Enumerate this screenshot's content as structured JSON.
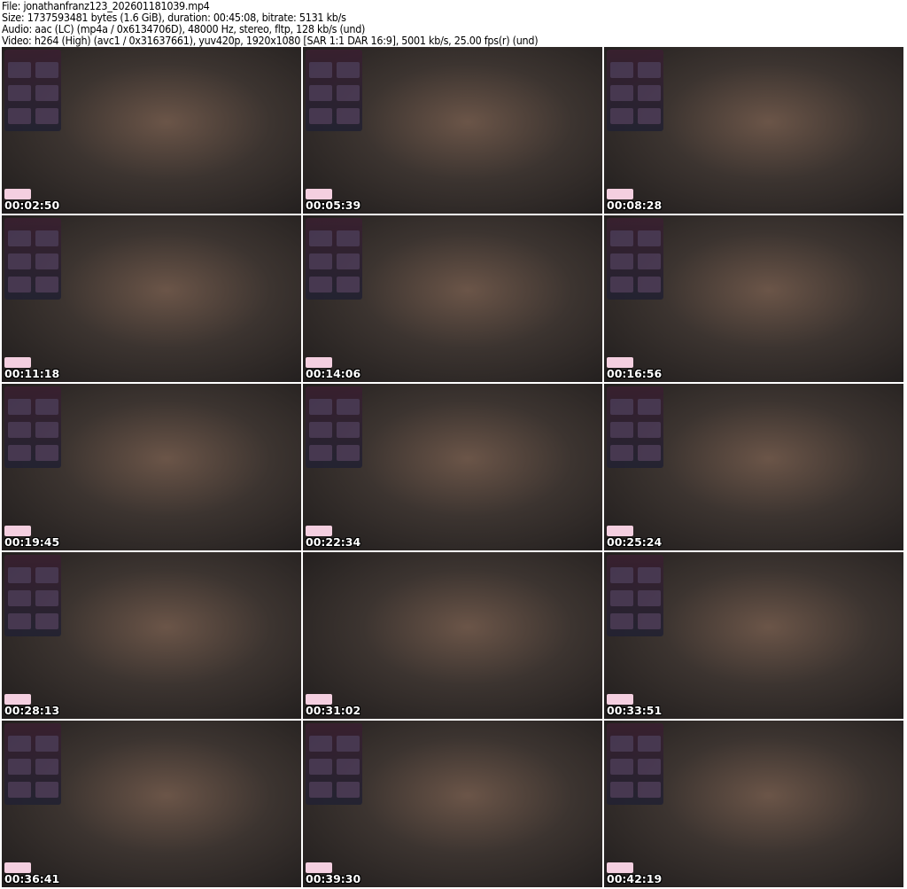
{
  "header": {
    "file": "File: jonathanfranz123_202601181039.mp4",
    "size": "Size: 1737593481 bytes (1.6 GiB), duration: 00:45:08, bitrate: 5131 kb/s",
    "audio": "Audio: aac (LC) (mp4a / 0x6134706D), 48000 Hz, stereo, fltp, 128 kb/s (und)",
    "video": "Video: h264 (High) (avc1 / 0x31637661), yuv420p, 1920x1080 [SAR 1:1 DAR 16:9], 5001 kb/s, 25.00 fps(r) (und)"
  },
  "thumbnails": [
    {
      "timestamp": "00:02:50"
    },
    {
      "timestamp": "00:05:39"
    },
    {
      "timestamp": "00:08:28"
    },
    {
      "timestamp": "00:11:18"
    },
    {
      "timestamp": "00:14:06"
    },
    {
      "timestamp": "00:16:56"
    },
    {
      "timestamp": "00:19:45"
    },
    {
      "timestamp": "00:22:34"
    },
    {
      "timestamp": "00:25:24"
    },
    {
      "timestamp": "00:28:13"
    },
    {
      "timestamp": "00:31:02"
    },
    {
      "timestamp": "00:33:51"
    },
    {
      "timestamp": "00:36:41"
    },
    {
      "timestamp": "00:39:30"
    },
    {
      "timestamp": "00:42:19"
    }
  ]
}
